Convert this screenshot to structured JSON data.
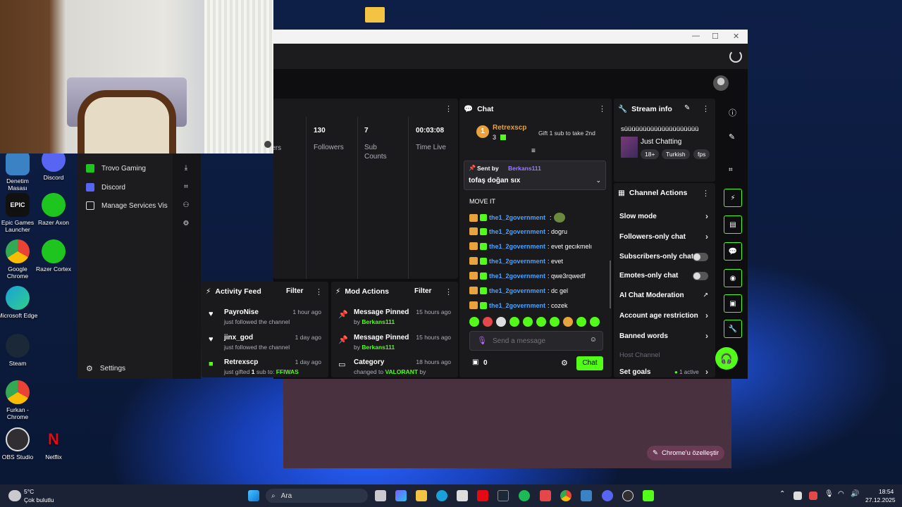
{
  "desktop": {
    "icons": [
      {
        "label": "Denetim Masası",
        "color": "#3b82c4"
      },
      {
        "label": "Discord",
        "color": "#5865f2"
      },
      {
        "label": "Epic Games Launcher",
        "color": "#111111"
      },
      {
        "label": "Razer Axon",
        "color": "#1ec51e"
      },
      {
        "label": "Google Chrome",
        "color": "#e8c12a"
      },
      {
        "label": "Razer Cortex",
        "color": "#1ec51e"
      },
      {
        "label": "Microsoft Edge",
        "color": "#1aa0d8"
      },
      {
        "label": "Steam",
        "color": "#1b2838"
      },
      {
        "label": "Furkan - Chrome",
        "color": "#e8c12a"
      },
      {
        "label": "OBS Studio",
        "color": "#302e31"
      },
      {
        "label": "Netflix",
        "color": "#e50914"
      }
    ]
  },
  "left_panel": {
    "items": [
      {
        "label": "Trovo Gaming"
      },
      {
        "label": "Discord"
      },
      {
        "label": "Manage Services Vis"
      }
    ],
    "settings_label": "Settings"
  },
  "stats": [
    {
      "value": "",
      "label": "wers"
    },
    {
      "value": "130",
      "label": "Followers"
    },
    {
      "value": "7",
      "label": "Sub Counts"
    },
    {
      "value": "00:03:08",
      "label": "Time Live"
    }
  ],
  "activity_feed": {
    "title": "Activity Feed",
    "filter": "Filter",
    "items": [
      {
        "name": "PayroNise",
        "sub": "just followed the channel",
        "time": "1 hour ago",
        "icon": "heart-icon"
      },
      {
        "name": "jinx_god",
        "sub": "just followed the channel",
        "time": "1 day ago",
        "icon": "heart-icon"
      },
      {
        "name": "Retrexscp",
        "sub_prefix": "just gifted ",
        "sub_count": "1",
        "sub_mid": " sub to: ",
        "sub_target": "FFIWAS",
        "time": "1 day ago",
        "icon": "gift-icon"
      }
    ]
  },
  "mod_actions": {
    "title": "Mod Actions",
    "filter": "Filter",
    "items": [
      {
        "title": "Message Pinned",
        "by": "by ",
        "user": "Berkans111",
        "time": "15 hours ago"
      },
      {
        "title": "Message Pinned",
        "by": "by ",
        "user": "Berkans111",
        "time": "15 hours ago"
      },
      {
        "title": "Category",
        "by": "changed to ",
        "user": "VALORANT",
        "suffix": " by",
        "time": "18 hours ago"
      }
    ]
  },
  "chat": {
    "title": "Chat",
    "leader": {
      "rank": "1",
      "name": "Retrexscp",
      "count": "3",
      "gift_text": "Gift 1 sub to take 2nd"
    },
    "pinned": {
      "sent_by": "Sent by",
      "user": "Berkans111",
      "message": "tofaş doğan sıx"
    },
    "top_message": "MOVE IT",
    "messages": [
      {
        "user": "the1_2government",
        "text": ""
      },
      {
        "user": "the1_2government",
        "text": ": dogru"
      },
      {
        "user": "the1_2government",
        "text": ": evet gecıkmelı"
      },
      {
        "user": "the1_2government",
        "text": ": evet"
      },
      {
        "user": "the1_2government",
        "text": ": qwe3rqwedf"
      },
      {
        "user": "the1_2government",
        "text": ": dc gel"
      },
      {
        "user": "the1_2government",
        "text": ": cozek"
      }
    ],
    "input_placeholder": "Send a message",
    "viewer_count": "0",
    "send_label": "Chat"
  },
  "stream_info": {
    "title": "Stream info",
    "stream_title": "süüüüüüüüüüüüüüüüüüüü",
    "category": "Just Chatting",
    "tags": [
      "18+",
      "Turkish",
      "fps"
    ]
  },
  "channel_actions": {
    "title": "Channel Actions",
    "rows": [
      {
        "label": "Slow mode",
        "control": "arrow"
      },
      {
        "label": "Followers-only chat",
        "control": "arrow"
      },
      {
        "label": "Subscribers-only chat",
        "control": "toggle"
      },
      {
        "label": "Emotes-only chat",
        "control": "toggle"
      },
      {
        "label": "AI Chat Moderation",
        "control": "chart"
      },
      {
        "label": "Account age restriction",
        "control": "arrow"
      },
      {
        "label": "Banned words",
        "control": "arrow"
      },
      {
        "label": "Host Channel",
        "control": "none"
      },
      {
        "label": "Set goals",
        "control": "arrow",
        "extra": "1 active"
      }
    ]
  },
  "chrome": {
    "customize_label": "Chrome'u özelleştir"
  },
  "taskbar": {
    "weather_temp": "5°C",
    "weather_desc": "Çok bulutlu",
    "search_placeholder": "Ara",
    "time": "18:54",
    "date": "27.12.2025"
  },
  "colors": {
    "accent": "#53fc18",
    "link": "#4aa3ff",
    "panel": "#1a1a1d",
    "background": "#0e0e10"
  }
}
